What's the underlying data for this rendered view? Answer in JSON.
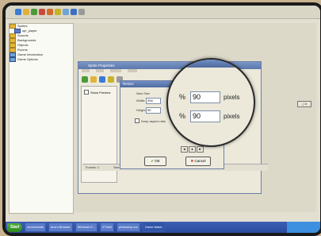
{
  "tree": {
    "items": [
      {
        "label": "Sprites"
      },
      {
        "label": "spr_player"
      },
      {
        "label": "Sounds"
      },
      {
        "label": "Backgrounds"
      },
      {
        "label": "Objects"
      },
      {
        "label": "Rooms"
      },
      {
        "label": "Game Information"
      },
      {
        "label": "Game Options"
      }
    ]
  },
  "sprite_window": {
    "title": "Sprite Properties",
    "side_label": "Show Preview",
    "status_frames": "Frames: 1",
    "status_size": "Size: 32 x 28",
    "status_transparent": "Transparent"
  },
  "resize_dialog": {
    "title": "Resize",
    "new_size": "New Size",
    "width_label": "Width:",
    "width_value": "294",
    "height_label": "Height:",
    "height_value": "90",
    "keep_aspect": "Keep aspect ratio",
    "ok": "OK",
    "cancel": "Cancel"
  },
  "zoom": {
    "percent_symbol": "%",
    "width_value": "90",
    "height_value": "90",
    "unit": "pixels"
  },
  "taskbar": {
    "start": "Start",
    "tasks": [
      "screenshots",
      "Acorn Browser",
      "Windows E...",
      "3 Paint",
      "photoshop.cur",
      "Game Maker"
    ]
  }
}
